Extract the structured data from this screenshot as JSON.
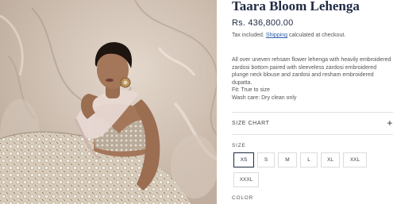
{
  "product": {
    "title": "Taara Bloom Lehenga",
    "price": "Rs. 436,800.00",
    "tax_prefix": "Tax included.",
    "tax_link": "Shipping",
    "tax_suffix": "calculated at checkout.",
    "description": "All over uneven rehsam flower lehenga with heavily embroidered zardosi bottom paired with sleeveless zardosi embroidered plunge neck blouse and zardosi and resham embroidered dupatta.",
    "fit": "Fit: True to size",
    "care": "Wash care: Dry clean only"
  },
  "size_chart": {
    "label": "SIZE CHART",
    "icon": "plus-icon"
  },
  "size_selector": {
    "label": "SIZE",
    "options": [
      "XS",
      "S",
      "M",
      "L",
      "XL",
      "XXL",
      "XXXL"
    ],
    "selected": "XS"
  },
  "color_selector": {
    "label": "COLOR"
  },
  "colors": {
    "title": "#1f2a44",
    "link": "#2e5ea8",
    "border": "#dcdcdc"
  }
}
